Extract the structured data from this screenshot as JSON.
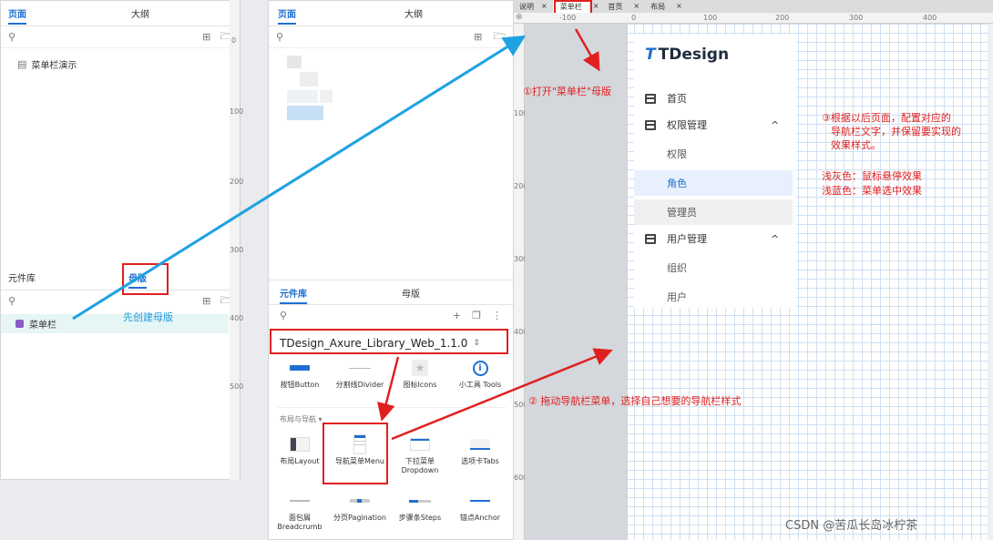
{
  "left_panel": {
    "tabs": [
      "页面",
      "大纲"
    ],
    "pages": [
      "菜单栏演示"
    ],
    "lower_tabs": [
      "元件库",
      "母版"
    ],
    "masters": [
      "菜单栏"
    ],
    "annotation": "先创建母版"
  },
  "ruler_left": [
    "0",
    "100",
    "200",
    "300",
    "400",
    "500"
  ],
  "middle_panel": {
    "tabs": [
      "页面",
      "大纲"
    ],
    "lower_tabs": [
      "元件库",
      "母版"
    ],
    "library_select": "TDesign_Axure_Library_Web_1.1.0",
    "row1": [
      "按钮Button",
      "分割线Divider",
      "图标Icons",
      "小工具 Tools"
    ],
    "section_label": "布局与导航 ▾",
    "row2": [
      "布局Layout",
      "导航菜单Menu",
      "下拉菜单 Dropdown",
      "选项卡Tabs"
    ],
    "row3": [
      "面包屑 Breadcrumb",
      "分页Pagination",
      "步骤条Steps",
      "锚点Anchor"
    ]
  },
  "canvas": {
    "doc_tabs": [
      "说明",
      "菜单栏",
      "首页",
      "布局"
    ],
    "ruler_top": [
      "-100",
      "0",
      "100",
      "200",
      "300",
      "400"
    ],
    "ruler_side": [
      "100",
      "200",
      "300",
      "400",
      "500",
      "600"
    ]
  },
  "tdesign_menu": {
    "logo": "TDesign",
    "items": [
      {
        "label": "首页"
      },
      {
        "label": "权限管理",
        "chevron": "^"
      },
      {
        "label": "权限"
      },
      {
        "label": "角色",
        "state": "selected"
      },
      {
        "label": "管理员",
        "state": "hover"
      },
      {
        "label": "用户管理",
        "chevron": "^"
      },
      {
        "label": "组织"
      },
      {
        "label": "用户"
      }
    ],
    "hover_color": "#f0f0f0",
    "selected_color": "#e8f0fe"
  },
  "annotations": {
    "step1": "①打开\"菜单栏\"母版",
    "step2": "② 拖动导航栏菜单，选择自己想要的导航栏样式",
    "step3_lines": [
      "③根据以后页面，配置对应的",
      "导航栏文字，并保留要实现的",
      "效果样式。"
    ],
    "legend_gray": "浅灰色：鼠标悬停效果",
    "legend_blue": "浅蓝色：菜单选中效果"
  },
  "watermark": "CSDN @苦瓜长岛冰柠茶"
}
